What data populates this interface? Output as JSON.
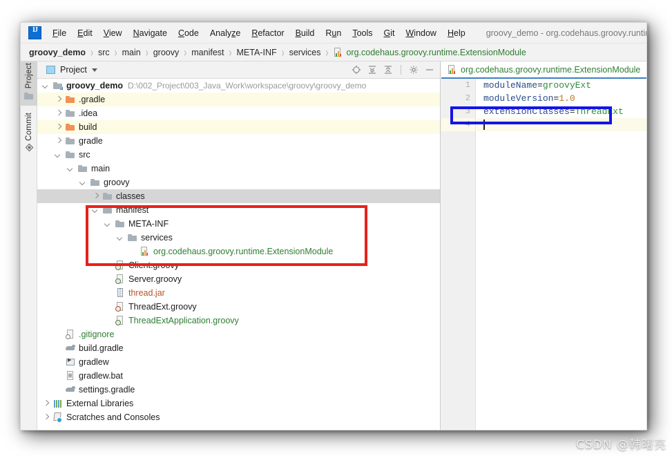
{
  "window": {
    "title": "groovy_demo - org.codehaus.groovy.runtime.E",
    "logo_text": "IJ"
  },
  "menubar": {
    "items": [
      {
        "label": "File",
        "mnemonic": "F"
      },
      {
        "label": "Edit",
        "mnemonic": "E"
      },
      {
        "label": "View",
        "mnemonic": "V"
      },
      {
        "label": "Navigate",
        "mnemonic": "N"
      },
      {
        "label": "Code",
        "mnemonic": "C"
      },
      {
        "label": "Analyze",
        "mnemonic": "z"
      },
      {
        "label": "Refactor",
        "mnemonic": "R"
      },
      {
        "label": "Build",
        "mnemonic": "B"
      },
      {
        "label": "Run",
        "mnemonic": "u"
      },
      {
        "label": "Tools",
        "mnemonic": "T"
      },
      {
        "label": "Git",
        "mnemonic": "G"
      },
      {
        "label": "Window",
        "mnemonic": "W"
      },
      {
        "label": "Help",
        "mnemonic": "H"
      }
    ]
  },
  "breadcrumb": {
    "items": [
      {
        "label": "groovy_demo",
        "style": "bold"
      },
      {
        "label": "src",
        "style": "normal"
      },
      {
        "label": "main",
        "style": "normal"
      },
      {
        "label": "groovy",
        "style": "normal"
      },
      {
        "label": "manifest",
        "style": "normal"
      },
      {
        "label": "META-INF",
        "style": "normal"
      },
      {
        "label": "services",
        "style": "normal"
      },
      {
        "label": "org.codehaus.groovy.runtime.ExtensionModule",
        "style": "green",
        "icon": "bar-chart-file-icon"
      }
    ],
    "separator": "›"
  },
  "toolstrip": {
    "buttons": [
      {
        "label": "Project",
        "icon": "folder-icon",
        "active": true
      },
      {
        "label": "Commit",
        "icon": "commit-diamond-icon",
        "active": false
      }
    ]
  },
  "project_panel": {
    "title": "Project",
    "icons": [
      {
        "name": "locate-target-icon"
      },
      {
        "name": "expand-all-icon"
      },
      {
        "name": "collapse-all-icon"
      },
      {
        "name": "settings-gear-icon"
      },
      {
        "name": "minimize-icon"
      }
    ],
    "tree": [
      {
        "label": "groovy_demo",
        "path": "D:\\002_Project\\003_Java_Work\\workspace\\groovy\\groovy_demo",
        "indent": 0,
        "arrow": "down",
        "icon": "module-folder-icon",
        "style": "bold",
        "row": "normal"
      },
      {
        "label": ".gradle",
        "indent": 1,
        "arrow": "right",
        "icon": "folder-excluded-icon",
        "style": "normal",
        "row": "excluded"
      },
      {
        "label": ".idea",
        "indent": 1,
        "arrow": "right",
        "icon": "folder-icon",
        "style": "normal",
        "row": "normal"
      },
      {
        "label": "build",
        "indent": 1,
        "arrow": "right",
        "icon": "folder-excluded-icon",
        "style": "normal",
        "row": "excluded"
      },
      {
        "label": "gradle",
        "indent": 1,
        "arrow": "right",
        "icon": "folder-icon",
        "style": "normal",
        "row": "normal"
      },
      {
        "label": "src",
        "indent": 1,
        "arrow": "down",
        "icon": "folder-icon",
        "style": "normal",
        "row": "normal"
      },
      {
        "label": "main",
        "indent": 2,
        "arrow": "down",
        "icon": "folder-icon",
        "style": "normal",
        "row": "normal"
      },
      {
        "label": "groovy",
        "indent": 3,
        "arrow": "down",
        "icon": "folder-icon",
        "style": "normal",
        "row": "normal"
      },
      {
        "label": "classes",
        "indent": 4,
        "arrow": "right",
        "icon": "folder-icon",
        "style": "normal",
        "row": "selected"
      },
      {
        "label": "manifest",
        "indent": 4,
        "arrow": "down",
        "icon": "folder-icon",
        "style": "normal",
        "row": "normal"
      },
      {
        "label": "META-INF",
        "indent": 5,
        "arrow": "down",
        "icon": "folder-icon",
        "style": "normal",
        "row": "normal"
      },
      {
        "label": "services",
        "indent": 6,
        "arrow": "down",
        "icon": "folder-icon",
        "style": "normal",
        "row": "normal"
      },
      {
        "label": "org.codehaus.groovy.runtime.ExtensionModule",
        "indent": 7,
        "arrow": "none",
        "icon": "bar-chart-file-icon",
        "style": "green",
        "row": "normal"
      },
      {
        "label": "Client.groovy",
        "indent": 5,
        "arrow": "none",
        "icon": "groovy-file-icon",
        "style": "normal",
        "row": "normal"
      },
      {
        "label": "Server.groovy",
        "indent": 5,
        "arrow": "none",
        "icon": "groovy-file-icon",
        "style": "normal",
        "row": "normal"
      },
      {
        "label": "thread.jar",
        "indent": 5,
        "arrow": "none",
        "icon": "jar-file-icon",
        "style": "orange",
        "row": "normal"
      },
      {
        "label": "ThreadExt.groovy",
        "indent": 5,
        "arrow": "none",
        "icon": "groovy-file-red-icon",
        "style": "normal",
        "row": "normal"
      },
      {
        "label": "ThreadExtApplication.groovy",
        "indent": 5,
        "arrow": "none",
        "icon": "groovy-file-icon",
        "style": "green",
        "row": "normal"
      },
      {
        "label": ".gitignore",
        "indent": 1,
        "arrow": "none",
        "icon": "gitignore-file-icon",
        "style": "green",
        "row": "normal"
      },
      {
        "label": "build.gradle",
        "indent": 1,
        "arrow": "none",
        "icon": "gradle-file-icon",
        "style": "normal",
        "row": "normal"
      },
      {
        "label": "gradlew",
        "indent": 1,
        "arrow": "none",
        "icon": "executable-file-icon",
        "style": "normal",
        "row": "normal"
      },
      {
        "label": "gradlew.bat",
        "indent": 1,
        "arrow": "none",
        "icon": "bat-file-icon",
        "style": "normal",
        "row": "normal"
      },
      {
        "label": "settings.gradle",
        "indent": 1,
        "arrow": "none",
        "icon": "gradle-file-icon",
        "style": "normal",
        "row": "normal"
      },
      {
        "label": "External Libraries",
        "indent": 0,
        "arrow": "right",
        "icon": "libraries-icon",
        "style": "normal",
        "row": "normal"
      },
      {
        "label": "Scratches and Consoles",
        "indent": 0,
        "arrow": "right",
        "icon": "scratches-icon",
        "style": "normal",
        "row": "normal"
      }
    ]
  },
  "editor": {
    "tab": {
      "label": "org.codehaus.groovy.runtime.ExtensionModule",
      "icon": "bar-chart-file-icon",
      "close": "×"
    },
    "lines": [
      {
        "number": "1",
        "key": "moduleName",
        "eq": "=",
        "value": "groovyExt",
        "value_kind": "string",
        "caret": false
      },
      {
        "number": "2",
        "key": "moduleVersion",
        "eq": "=",
        "value": "1.0",
        "value_kind": "number",
        "caret": false
      },
      {
        "number": "3",
        "key": "extensionClasses",
        "eq": "=",
        "value": "ThreadExt",
        "value_kind": "string",
        "caret": false
      },
      {
        "number": "4",
        "key": "",
        "eq": "",
        "value": "",
        "value_kind": "none",
        "caret": true
      }
    ]
  },
  "annotations": {
    "red_box_target": "manifest/META-INF/services/org.codehaus.groovy.runtime.ExtensionModule",
    "blue_box_target": "extensionClasses=ThreadExt"
  },
  "watermark": {
    "text": "CSDN @韩曙亮"
  },
  "colors": {
    "accent_blue": "#3e7ec4",
    "annotation_red": "#e8201b",
    "annotation_blue": "#1414e6",
    "green_text": "#2f7d32",
    "orange_text": "#b8502a",
    "excluded_row": "#fdfbe3",
    "selected_row": "#d6d6d6",
    "caret_line": "#fcfae8"
  }
}
